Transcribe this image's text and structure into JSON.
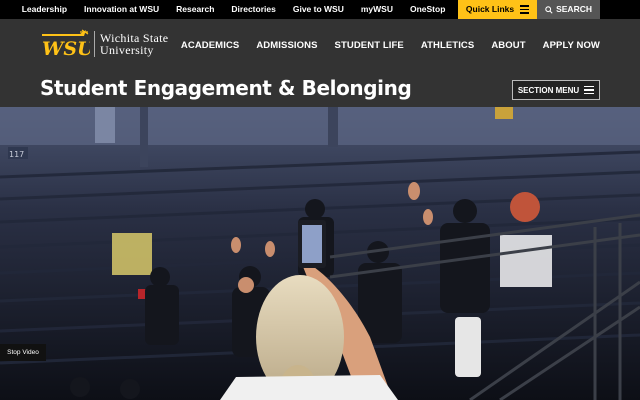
{
  "utility_nav": {
    "links": [
      "Leadership",
      "Innovation at WSU",
      "Research",
      "Directories",
      "Give to WSU",
      "myWSU",
      "OneStop"
    ],
    "quick_links_label": "Quick Links",
    "search_label": "SEARCH"
  },
  "brand": {
    "logo_text": "WSU",
    "name_line1": "Wichita State",
    "name_line2": "University",
    "accent_color": "#ffc217"
  },
  "main_nav": {
    "items": [
      "ACADEMICS",
      "ADMISSIONS",
      "STUDENT LIFE",
      "ATHLETICS",
      "ABOUT",
      "APPLY NOW"
    ]
  },
  "section": {
    "title": "Student Engagement & Belonging",
    "menu_label": "SECTION MENU"
  },
  "hero": {
    "section_number": "117",
    "exit_sign": "EXIT",
    "stop_video_label": "Stop Video"
  }
}
